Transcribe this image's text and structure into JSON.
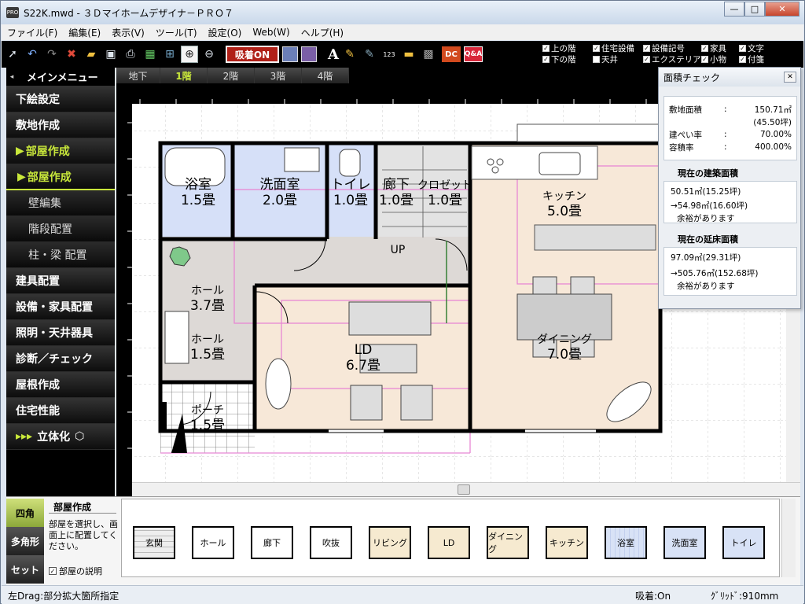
{
  "window": {
    "title": "S22K.mwd - ３Ｄマイホームデザイナ－ＰＲＯ７",
    "app_icon": "PRO",
    "controls": {
      "minimize": "—",
      "maximize": "□",
      "close": "✕"
    }
  },
  "menu": [
    "ファイル(F)",
    "編集(E)",
    "表示(V)",
    "ツール(T)",
    "設定(O)",
    "Web(W)",
    "ヘルプ(H)"
  ],
  "toolbar": {
    "kyuchaku": "吸着ON",
    "text_tool": "A",
    "dimension_tool": "123",
    "dc": "DC",
    "qa": "Q&A",
    "checks": [
      {
        "label": "上の階",
        "checked": true
      },
      {
        "label": "住宅設備",
        "checked": true
      },
      {
        "label": "設備記号",
        "checked": true
      },
      {
        "label": "家具",
        "checked": true
      },
      {
        "label": "文字",
        "checked": true
      },
      {
        "label": "下の階",
        "checked": true
      },
      {
        "label": "天井",
        "checked": false
      },
      {
        "label": "エクステリア",
        "checked": true
      },
      {
        "label": "小物",
        "checked": true
      },
      {
        "label": "付箋",
        "checked": true
      }
    ]
  },
  "sidebar": {
    "header": "メインメニュー",
    "header_arrow": "◂",
    "items": [
      {
        "label": "下絵設定",
        "type": "main",
        "active": false
      },
      {
        "label": "敷地作成",
        "type": "main",
        "active": false
      },
      {
        "label": "部屋作成",
        "type": "main",
        "active": true
      },
      {
        "label": "部屋作成",
        "type": "sub",
        "active": true
      },
      {
        "label": "壁編集",
        "type": "sub",
        "active": false
      },
      {
        "label": "階段配置",
        "type": "sub",
        "active": false
      },
      {
        "label": "柱・梁 配置",
        "type": "sub",
        "active": false
      },
      {
        "label": "建具配置",
        "type": "main",
        "active": false
      },
      {
        "label": "設備・家具配置",
        "type": "main",
        "active": false
      },
      {
        "label": "照明・天井器具",
        "type": "main",
        "active": false
      },
      {
        "label": "診断／チェック",
        "type": "main",
        "active": false
      },
      {
        "label": "屋根作成",
        "type": "main",
        "active": false
      },
      {
        "label": "住宅性能",
        "type": "main",
        "active": false
      },
      {
        "label": "立体化",
        "type": "main",
        "active": false
      }
    ]
  },
  "floor_tabs": [
    {
      "label": "地下",
      "active": false
    },
    {
      "label": "1階",
      "active": true
    },
    {
      "label": "2階",
      "active": false
    },
    {
      "label": "3階",
      "active": false
    },
    {
      "label": "4階",
      "active": false
    }
  ],
  "plan": {
    "rooms": [
      {
        "name": "浴室",
        "size": "1.5畳"
      },
      {
        "name": "洗面室",
        "size": "2.0畳"
      },
      {
        "name": "トイレ",
        "size": "1.0畳"
      },
      {
        "name": "廊下",
        "size": "1.0畳"
      },
      {
        "name": "クロゼット",
        "size": "1.0畳"
      },
      {
        "name": "キッチン",
        "size": "5.0畳"
      },
      {
        "name": "ホール",
        "size": "3.7畳"
      },
      {
        "name": "ホール",
        "size": "1.5畳"
      },
      {
        "name": "LD",
        "size": "6.7畳"
      },
      {
        "name": "ダイニング",
        "size": "7.0畳"
      },
      {
        "name": "ポーチ",
        "size": "1.5畳"
      }
    ],
    "stairs_label": "UP"
  },
  "area_check": {
    "title": "面積チェック",
    "site_area_label": "敷地面積",
    "site_area": "150.71㎡",
    "site_area_tsubo": "(45.50坪)",
    "coverage_label": "建ぺい率",
    "coverage": "70.00%",
    "far_label": "容積率",
    "far": "400.00%",
    "building_title": "現在の建築面積",
    "building_current": "50.51㎡(15.25坪)",
    "building_max": "→54.98㎡(16.60坪)",
    "building_note": "余裕があります",
    "floor_title": "現在の延床面積",
    "floor_current": "97.09㎡(29.31坪)",
    "floor_max": "→505.76㎡(152.68坪)",
    "floor_note": "余裕があります",
    "colon": ":"
  },
  "bottom": {
    "tabs": [
      "四角",
      "多角形",
      "セット"
    ],
    "desc_title": "部屋作成",
    "desc_text": "部屋を選択し、画面上に配置してください。",
    "desc_check": "部屋の説明",
    "parts": [
      {
        "label": "玄関",
        "color": "#d8d8d8",
        "hatch": true
      },
      {
        "label": "ホール",
        "color": "#ffffff"
      },
      {
        "label": "廊下",
        "color": "#ffffff"
      },
      {
        "label": "吹抜",
        "color": "#ffffff"
      },
      {
        "label": "リビング",
        "color": "#f6ead0"
      },
      {
        "label": "LD",
        "color": "#f6ead0"
      },
      {
        "label": "ダイニング",
        "color": "#f6ead0"
      },
      {
        "label": "キッチン",
        "color": "#f6ead0"
      },
      {
        "label": "浴室",
        "color": "#d8e2f6"
      },
      {
        "label": "洗面室",
        "color": "#d8e2f6"
      },
      {
        "label": "トイレ",
        "color": "#d8e2f6"
      }
    ]
  },
  "status": {
    "hint": "左Drag:部分拡大箇所指定",
    "snap": "吸着:On",
    "grid": "ｸﾞﾘｯﾄﾞ:910mm"
  }
}
